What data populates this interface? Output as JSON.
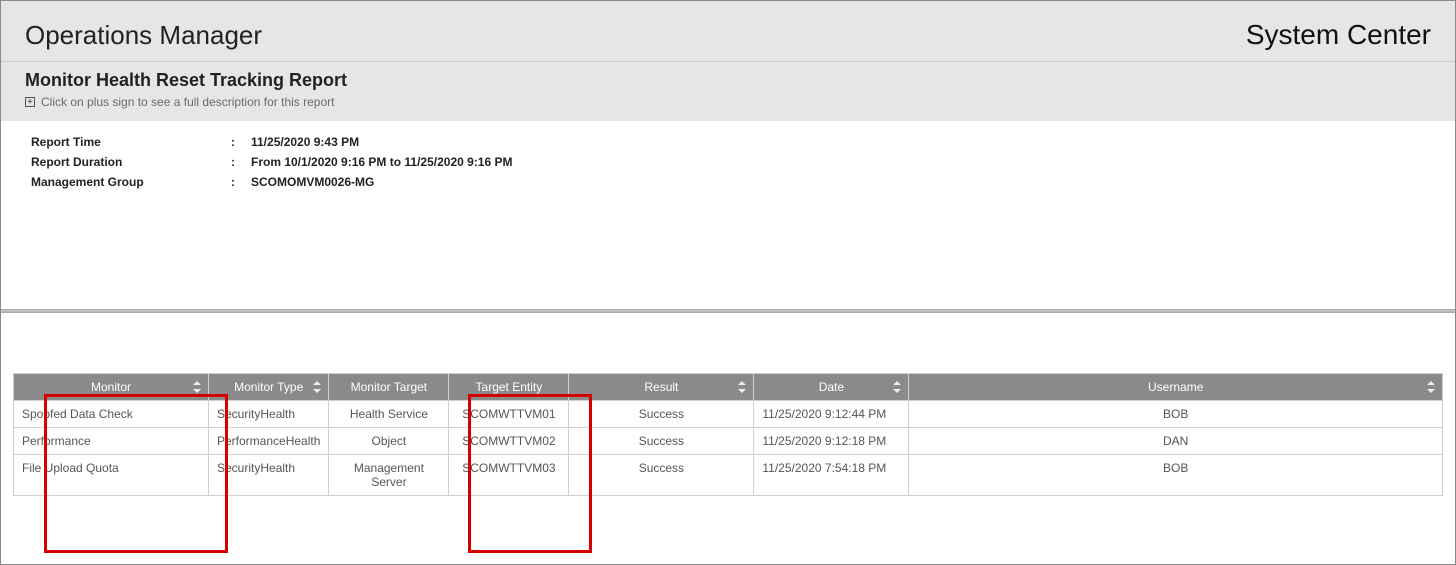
{
  "header": {
    "app": "Operations Manager",
    "brand": "System Center"
  },
  "sub": {
    "title": "Monitor Health Reset Tracking Report",
    "hint": "Click on plus sign to see a full description for this report"
  },
  "meta": {
    "time_label": "Report Time",
    "time_value": "11/25/2020 9:43 PM",
    "dur_label": "Report Duration",
    "dur_value": "From  10/1/2020 9:16 PM  to  11/25/2020 9:16 PM",
    "mg_label": "Management Group",
    "mg_value": "SCOMOMVM0026-MG"
  },
  "cols": {
    "monitor": "Monitor",
    "mtype": "Monitor Type",
    "mtarget": "Monitor Target",
    "tentity": "Target Entity",
    "result": "Result",
    "date": "Date",
    "user": "Username"
  },
  "rows": [
    {
      "monitor": "Spoofed Data Check",
      "mtype": "SecurityHealth",
      "mtarget": "Health Service",
      "tentity": "SCOMWTTVM01",
      "result": "Success",
      "date": "11/25/2020 9:12:44 PM",
      "user": "BOB"
    },
    {
      "monitor": "Performance",
      "mtype": "PerformanceHealth",
      "mtarget": "Object",
      "tentity": "SCOMWTTVM02",
      "result": "Success",
      "date": "11/25/2020 9:12:18 PM",
      "user": "DAN"
    },
    {
      "monitor": "File Upload Quota",
      "mtype": "SecurityHealth",
      "mtarget": "Management Server",
      "tentity": "SCOMWTTVM03",
      "result": "Success",
      "date": "11/25/2020 7:54:18 PM",
      "user": "BOB"
    }
  ]
}
